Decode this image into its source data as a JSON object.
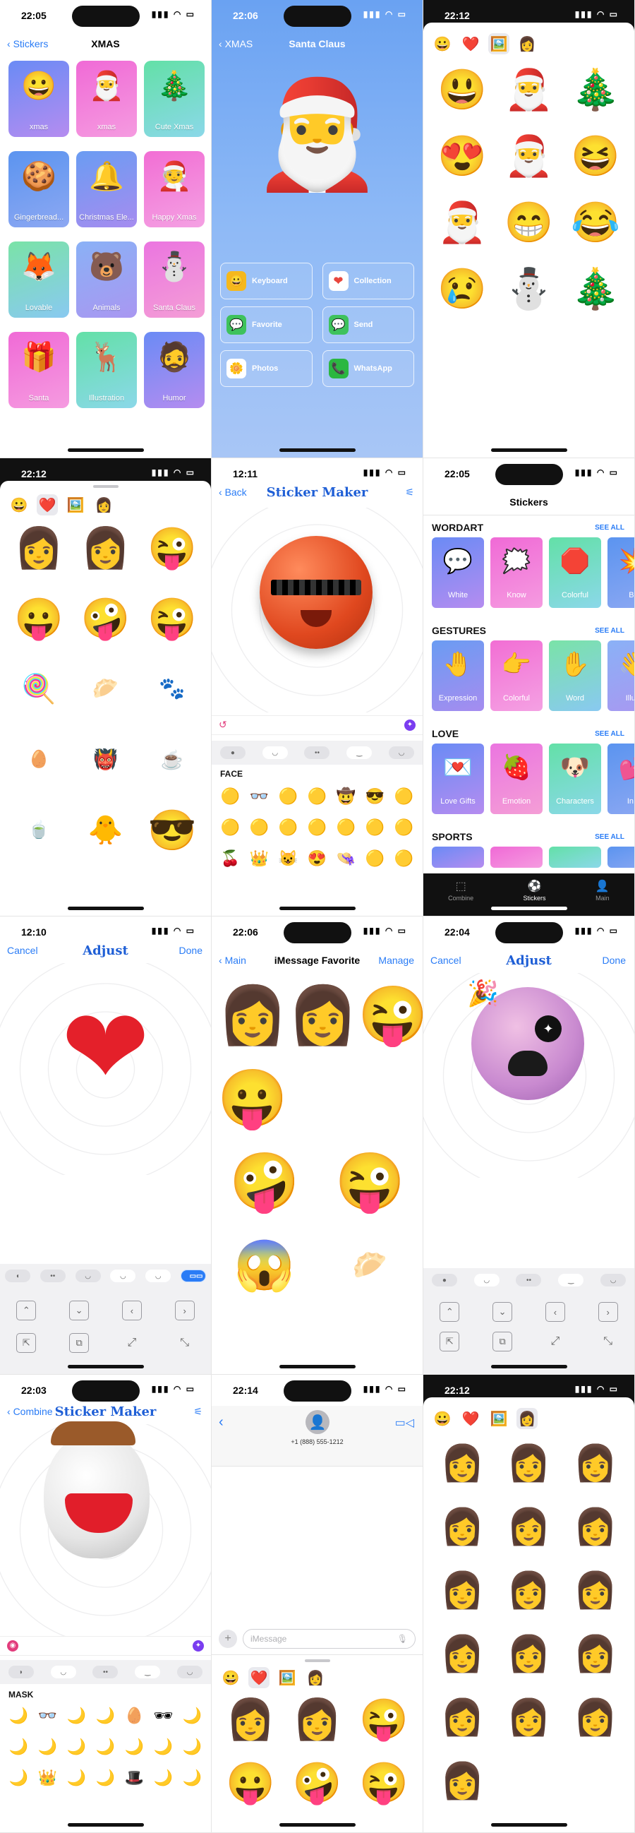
{
  "screen1": {
    "time": "22:05",
    "back": "Stickers",
    "title": "XMAS",
    "cards": [
      {
        "label": "xmas",
        "emoji": "😀"
      },
      {
        "label": "xmas",
        "emoji": "🎅"
      },
      {
        "label": "Cute Xmas",
        "emoji": "🎄"
      },
      {
        "label": "Gingerbread...",
        "emoji": "🍪"
      },
      {
        "label": "Christmas Ele...",
        "emoji": "🔔"
      },
      {
        "label": "Happy Xmas",
        "emoji": "🧑‍🎄"
      },
      {
        "label": "Lovable",
        "emoji": "🦊"
      },
      {
        "label": "Animals",
        "emoji": "🐻"
      },
      {
        "label": "Santa Claus",
        "emoji": "⛄"
      },
      {
        "label": "Santa",
        "emoji": "🎁"
      },
      {
        "label": "Illustration",
        "emoji": "🦌"
      },
      {
        "label": "Humor",
        "emoji": "🧔"
      }
    ]
  },
  "screen2": {
    "time": "22:06",
    "back": "XMAS",
    "title": "Santa Claus",
    "actions": [
      {
        "label": "Keyboard",
        "icon": "😀",
        "color": "#f5b81c"
      },
      {
        "label": "Collection",
        "icon": "❤",
        "color": "#e8463d"
      },
      {
        "label": "Favorite",
        "icon": "💬",
        "color": "#3ec25c"
      },
      {
        "label": "Send",
        "icon": "💬",
        "color": "#3ec25c"
      },
      {
        "label": "Photos",
        "icon": "🌼",
        "color": "#ffffff"
      },
      {
        "label": "WhatsApp",
        "icon": "📞",
        "color": "#2bb741"
      }
    ]
  },
  "screen3": {
    "time": "22:12",
    "tabs": [
      "😀",
      "❤️",
      "🖼️",
      "👩"
    ],
    "stickers": [
      "😃",
      "🎅",
      "🎄",
      "😍",
      "🎅",
      "😆",
      "🎅",
      "😁",
      "😂",
      "😢",
      "⛄",
      "🎄"
    ]
  },
  "screen4": {
    "time": "22:12",
    "tabs": [
      "😀",
      "❤️",
      "🖼️",
      "👩"
    ],
    "stickers": [
      "👩",
      "👩",
      "😜",
      "😛",
      "🤪",
      "😜",
      "🍭",
      "🥟",
      "🐾",
      "🥚",
      "👹",
      "☕",
      "🍵",
      "🐥",
      "😎"
    ]
  },
  "screen5": {
    "time": "12:11",
    "back": "Back",
    "title": "Sticker Maker",
    "section": "FACE",
    "face_items": [
      "🟡",
      "👓",
      "🟡",
      "🟡",
      "🤠",
      "😎",
      "🟡",
      "🟡",
      "🟡",
      "🟡",
      "🟡",
      "🟡",
      "🟡",
      "🟡",
      "🍒",
      "👑",
      "😺",
      "😍",
      "👒",
      "🟡",
      "🟡"
    ]
  },
  "screen6": {
    "time": "22:05",
    "title": "Stickers",
    "categories": [
      {
        "name": "WORDART",
        "see_all": "SEE ALL",
        "items": [
          {
            "label": "White",
            "emoji": "💬"
          },
          {
            "label": "Know",
            "emoji": "🗯️"
          },
          {
            "label": "Colorful",
            "emoji": "🛑"
          },
          {
            "label": "Bo",
            "emoji": "💥"
          }
        ]
      },
      {
        "name": "GESTURES",
        "see_all": "SEE ALL",
        "items": [
          {
            "label": "Expression",
            "emoji": "🤚"
          },
          {
            "label": "Colorful",
            "emoji": "👉"
          },
          {
            "label": "Word",
            "emoji": "✋"
          },
          {
            "label": "Illust",
            "emoji": "👋"
          }
        ]
      },
      {
        "name": "LOVE",
        "see_all": "SEE ALL",
        "items": [
          {
            "label": "Love Gifts",
            "emoji": "💌"
          },
          {
            "label": "Emotion",
            "emoji": "🍓"
          },
          {
            "label": "Characters",
            "emoji": "🐶"
          },
          {
            "label": "In L",
            "emoji": "💕"
          }
        ]
      },
      {
        "name": "SPORTS",
        "see_all": "SEE ALL",
        "items": []
      }
    ],
    "tabbar": [
      {
        "label": "Combine",
        "icon": "⬚"
      },
      {
        "label": "Stickers",
        "icon": "⚽"
      },
      {
        "label": "Main",
        "icon": "👤"
      }
    ]
  },
  "screen7": {
    "time": "12:10",
    "cancel": "Cancel",
    "title": "Adjust",
    "done": "Done"
  },
  "screen8": {
    "time": "22:06",
    "back": "Main",
    "title": "iMessage Favorite",
    "manage": "Manage",
    "stickers": [
      "👩",
      "👩",
      "😜",
      "😛",
      "🤪",
      "😜",
      "😱",
      "🥟"
    ]
  },
  "screen9": {
    "time": "22:04",
    "cancel": "Cancel",
    "title": "Adjust",
    "done": "Done"
  },
  "screen10": {
    "time": "22:03",
    "back": "Combine",
    "title": "Sticker Maker",
    "section": "MASK",
    "mask_items": [
      "🌙",
      "👓",
      "🌙",
      "🌙",
      "🥚",
      "🕶",
      "🌙",
      "🌙",
      "🌙",
      "🌙",
      "🌙",
      "🌙",
      "🌙",
      "🌙",
      "🌙",
      "👑",
      "🌙",
      "🌙",
      "🎩",
      "🌙",
      "🌙"
    ]
  },
  "screen11": {
    "time": "22:14",
    "phone": "+1 (888) 555-1212",
    "placeholder": "iMessage",
    "tabs": [
      "😀",
      "❤️",
      "🖼️",
      "👩"
    ],
    "stickers": [
      "👩",
      "👩",
      "😜",
      "😛",
      "🤪",
      "😜"
    ]
  },
  "screen12": {
    "time": "22:12",
    "tabs": [
      "😀",
      "❤️",
      "🖼️",
      "👩"
    ],
    "stickers": [
      "👩",
      "👩",
      "👩",
      "👩",
      "👩",
      "👩",
      "👩",
      "👩",
      "👩",
      "👩",
      "👩",
      "👩",
      "👩",
      "👩",
      "👩",
      "👩"
    ]
  }
}
